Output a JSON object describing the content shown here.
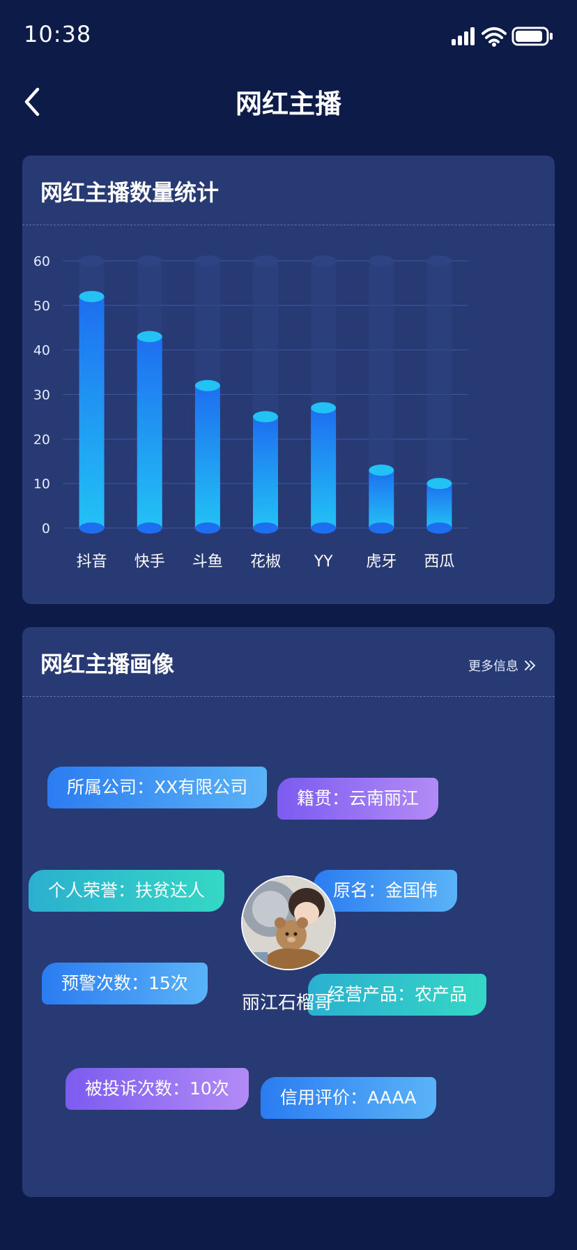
{
  "status_bar": {
    "time": "10:38",
    "icons": [
      "signal-icon",
      "wifi-icon",
      "battery-icon"
    ]
  },
  "nav": {
    "title": "网红主播",
    "back_icon": "chevron-left-icon"
  },
  "chart_card": {
    "title": "网红主播数量统计"
  },
  "chart_data": {
    "type": "bar",
    "categories": [
      "抖音",
      "快手",
      "斗鱼",
      "花椒",
      "YY",
      "虎牙",
      "西瓜"
    ],
    "values": [
      52,
      43,
      32,
      25,
      27,
      13,
      10
    ],
    "ylim": [
      0,
      60
    ],
    "yticks": [
      0,
      10,
      20,
      30,
      40,
      50,
      60
    ],
    "title": "",
    "xlabel": "",
    "ylabel": "",
    "grid": true,
    "colors": {
      "bar_top": "#1e6ef0",
      "bar_bottom": "#22c2f5",
      "cap": "#22c2f5",
      "track": "#2e4383"
    }
  },
  "profile_card": {
    "title": "网红主播画像",
    "more_label": "更多信息",
    "more_icon": "double-chevron-right-icon",
    "anchor_name": "丽江石榴哥",
    "tags": [
      {
        "text": "所属公司：XX有限公司",
        "style": "blue"
      },
      {
        "text": "籍贯：云南丽江",
        "style": "purple"
      },
      {
        "text": "个人荣誉：扶贫达人",
        "style": "teal"
      },
      {
        "text": "原名：金国伟",
        "style": "blue"
      },
      {
        "text": "预警次数：15次",
        "style": "blue"
      },
      {
        "text": "经营产品：农产品",
        "style": "teal"
      },
      {
        "text": "被投诉次数：10次",
        "style": "purple"
      },
      {
        "text": "信用评价：AAAA",
        "style": "blue"
      }
    ]
  },
  "colors": {
    "background": "#0c1b47",
    "card": "#283a74"
  }
}
